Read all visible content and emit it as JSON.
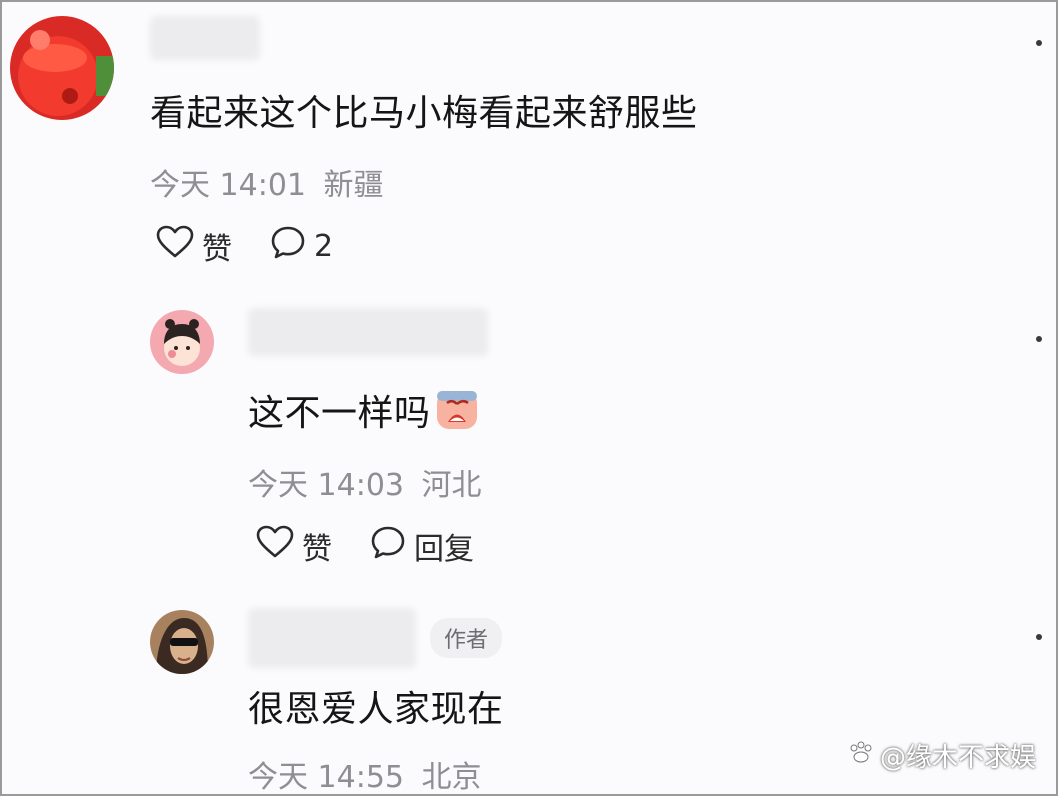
{
  "comments": [
    {
      "text": "看起来这个比马小梅看起来舒服些",
      "time": "今天 14:01",
      "location": "新疆",
      "like_label": "赞",
      "reply_label": "2"
    },
    {
      "text": "这不一样吗",
      "time": "今天 14:03",
      "location": "河北",
      "like_label": "赞",
      "reply_label": "回复"
    },
    {
      "text": "很恩爱人家现在",
      "time": "今天 14:55",
      "location": "北京",
      "badge": "作者"
    }
  ],
  "icons": {
    "like": "heart-outline-icon",
    "reply": "speech-bubble-icon",
    "more": "more-dots-icon"
  },
  "watermark": "@缘木不求娱",
  "colors": {
    "meta_text": "#8e8e93",
    "avatar_1": "#e8302a",
    "avatar_2": "#f4a9b0",
    "avatar_3": "#a8825f"
  }
}
